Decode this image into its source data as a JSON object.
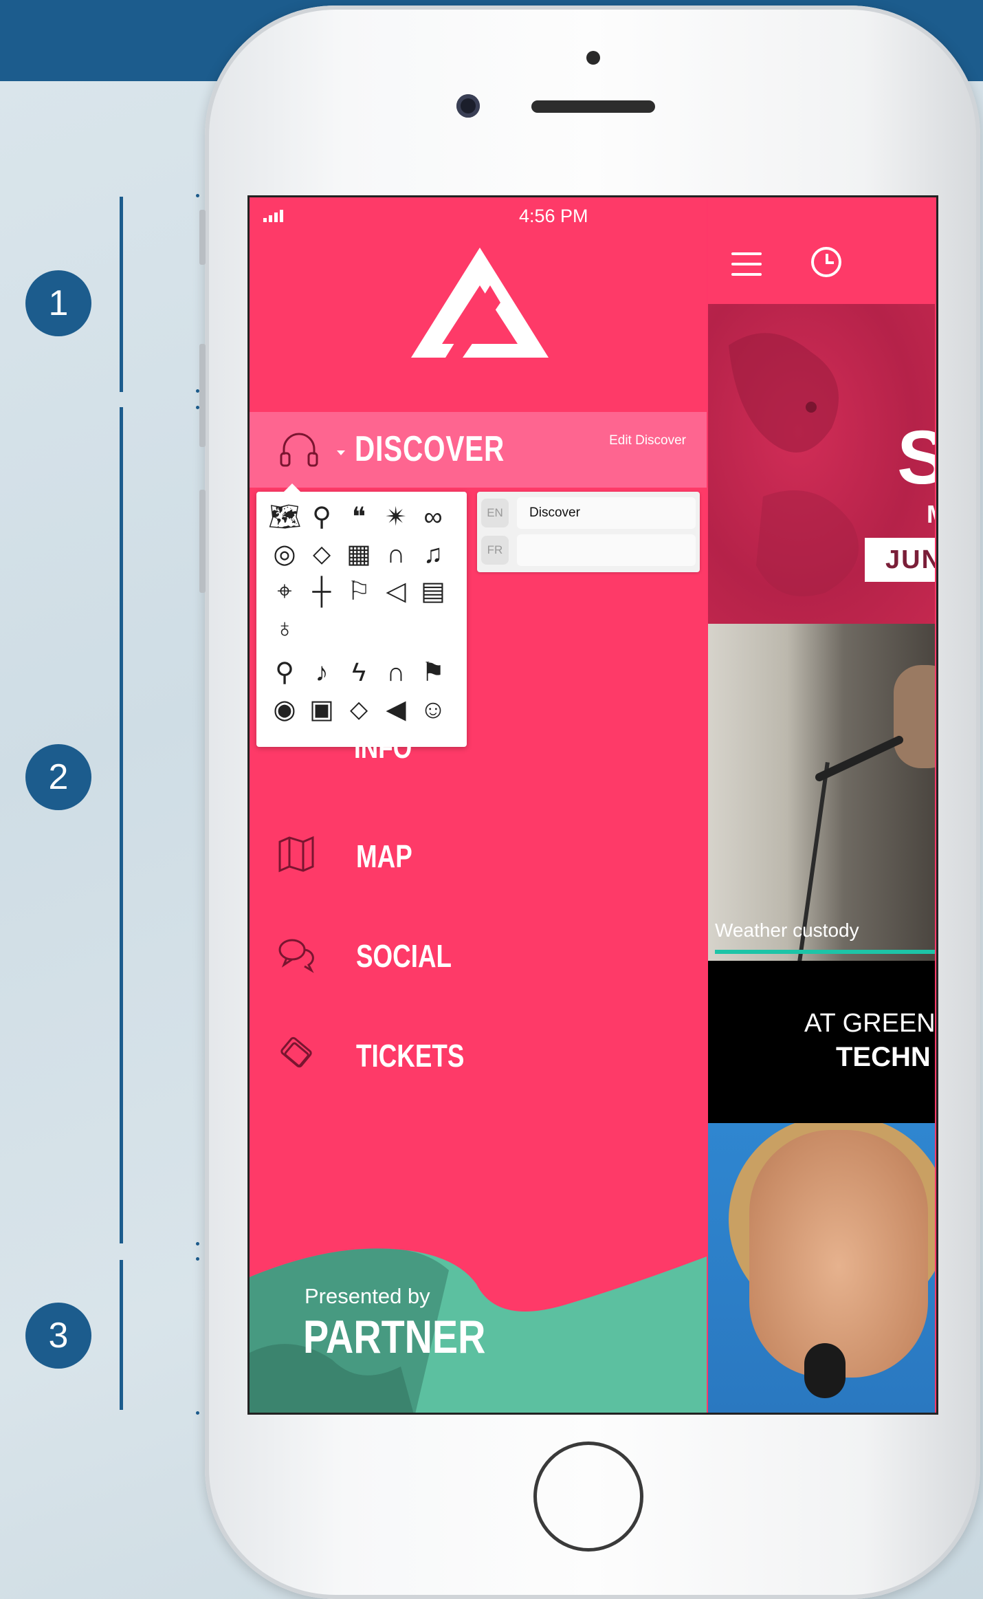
{
  "steps": [
    "1",
    "2",
    "3"
  ],
  "status": {
    "time": "4:56 PM"
  },
  "drawer": {
    "header": {
      "title": "DISCOVER",
      "edit_label": "Edit Discover"
    },
    "icon_picker": {
      "icons_row_a": [
        "map-icon",
        "pin-icon",
        "quote-icon",
        "bomb-icon",
        "glasses-icon",
        "speaker-icon",
        "ticket-icon",
        "schedule-icon",
        "headphones-icon",
        "music-note-icon",
        "map-pin-icon",
        "signpost-icon",
        "flag-icon",
        "megaphone-icon",
        "calendar-icon",
        "microphone-icon"
      ],
      "icons_row_b": [
        "pin-icon",
        "music-note-icon",
        "lightning-icon",
        "headphones-icon",
        "flag-icon",
        "eye-icon",
        "calendar-23-icon",
        "ticket-icon",
        "megaphone-icon",
        "user-icon"
      ]
    },
    "languages": [
      {
        "code": "EN",
        "value": "Discover"
      },
      {
        "code": "FR",
        "value": ""
      }
    ],
    "menu": [
      {
        "label": "INFO"
      },
      {
        "label": "MAP"
      },
      {
        "label": "SOCIAL"
      },
      {
        "label": "TICKETS"
      }
    ],
    "partner": {
      "presented_by": "Presented by",
      "name": "PARTNER"
    }
  },
  "feed": {
    "card1": {
      "headline": "S",
      "sub": "M",
      "date": "JUNE"
    },
    "card2": {
      "caption": "Weather custody"
    },
    "card3": {
      "line1": "AT GREEN",
      "line2": "TECHN"
    }
  },
  "colors": {
    "brand": "#fe3a68",
    "accent": "#1ec4a7",
    "annotation": "#1c5c8d"
  }
}
